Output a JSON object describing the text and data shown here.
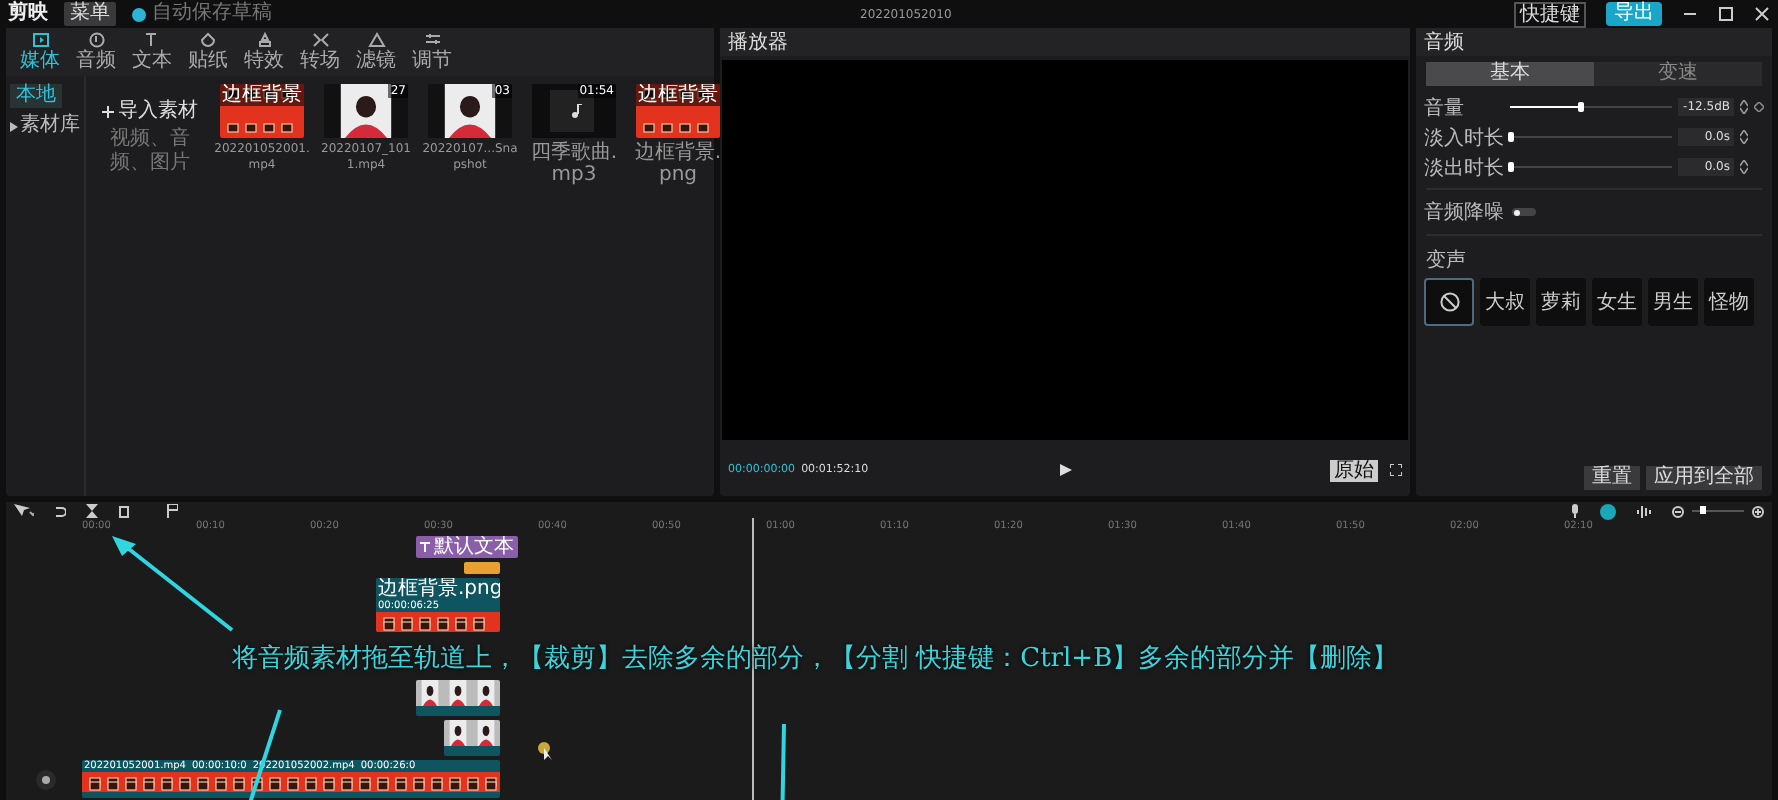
{
  "app": {
    "name": "剪映",
    "menu": "菜单",
    "notice": "自动保存草稿",
    "project_title": "202201052010",
    "shortcut": "快捷键",
    "export": "导出"
  },
  "tool_tabs": [
    {
      "label": "媒体",
      "selected": true,
      "kind": "media"
    },
    {
      "label": "音频",
      "selected": false,
      "kind": "audio"
    },
    {
      "label": "文本",
      "selected": false,
      "kind": "text"
    },
    {
      "label": "贴纸",
      "selected": false,
      "kind": "sticker"
    },
    {
      "label": "特效",
      "selected": false,
      "kind": "effect"
    },
    {
      "label": "转场",
      "selected": false,
      "kind": "transition"
    },
    {
      "label": "滤镜",
      "selected": false,
      "kind": "filter"
    },
    {
      "label": "调节",
      "selected": false,
      "kind": "adjust"
    }
  ],
  "sidebar": {
    "items": [
      {
        "label": "本地",
        "selected": true
      },
      {
        "label": "素材库",
        "selected": false
      }
    ]
  },
  "import": {
    "label": "导入素材",
    "hint": "视频、音频、图片"
  },
  "media": [
    {
      "kind": "red",
      "name": "202201052001.mp4",
      "badge": "边框背景"
    },
    {
      "name": "20220107_1011.mp4",
      "badge": "27"
    },
    {
      "name": "20220107...Snapshot",
      "badge": "03"
    },
    {
      "kind": "audio",
      "name": "四季歌曲.mp3",
      "badge": "01:54"
    },
    {
      "kind": "red",
      "name": "边框背景.png",
      "badge": "边框背景"
    }
  ],
  "player": {
    "title": "播放器",
    "current": "00:00:00:00",
    "total": "00:01:52:10",
    "ratio": "原始"
  },
  "inspector": {
    "title": "音频",
    "tabs": [
      {
        "label": "基本",
        "selected": true
      },
      {
        "label": "变速",
        "selected": false
      }
    ],
    "sliders": [
      {
        "label": "音量",
        "level": 0.43,
        "reading": "-12.5dB"
      },
      {
        "label": "淡入时长",
        "level": 0.0,
        "reading": "0.0s"
      },
      {
        "label": "淡出时长",
        "level": 0.0,
        "reading": "0.0s"
      }
    ],
    "denoise": {
      "label": "音频降噪",
      "on": false
    },
    "voice_label": "变声",
    "voices": [
      {
        "selected": true,
        "kind": "none"
      },
      {
        "label": "大叔",
        "selected": false,
        "kind": "text"
      },
      {
        "label": "萝莉",
        "selected": false,
        "kind": "text"
      },
      {
        "label": "女生",
        "selected": false,
        "kind": "text"
      },
      {
        "label": "男生",
        "selected": false,
        "kind": "text"
      },
      {
        "label": "怪物",
        "selected": false,
        "kind": "text"
      }
    ],
    "buttons": [
      "重置",
      "应用到全部"
    ]
  },
  "zoom": {
    "level": 0.15
  },
  "ruler": [
    "00:00",
    "00:10",
    "00:20",
    "00:30",
    "00:40",
    "00:50",
    "01:00",
    "01:10",
    "01:20",
    "01:30",
    "01:40",
    "01:50",
    "02:00",
    "02:10"
  ],
  "clips": [
    {
      "kind": "text",
      "label": "默认文本"
    },
    {
      "kind": "sticker"
    },
    {
      "kind": "red",
      "label": "边框背景.png",
      "time": "00:00:06:25"
    },
    {
      "kind": "photos"
    },
    {
      "kind": "photos2"
    },
    {
      "kind": "main",
      "label": "202201052001.mp4",
      "time": "00:00:10:0",
      "label2": "202201052002.mp4",
      "time2": "00:00:26:0"
    }
  ],
  "caption": "将音频素材拖至轨道上，【裁剪】去除多余的部分，【分割 快捷键：Ctrl+B】多余的部分并【删除】"
}
